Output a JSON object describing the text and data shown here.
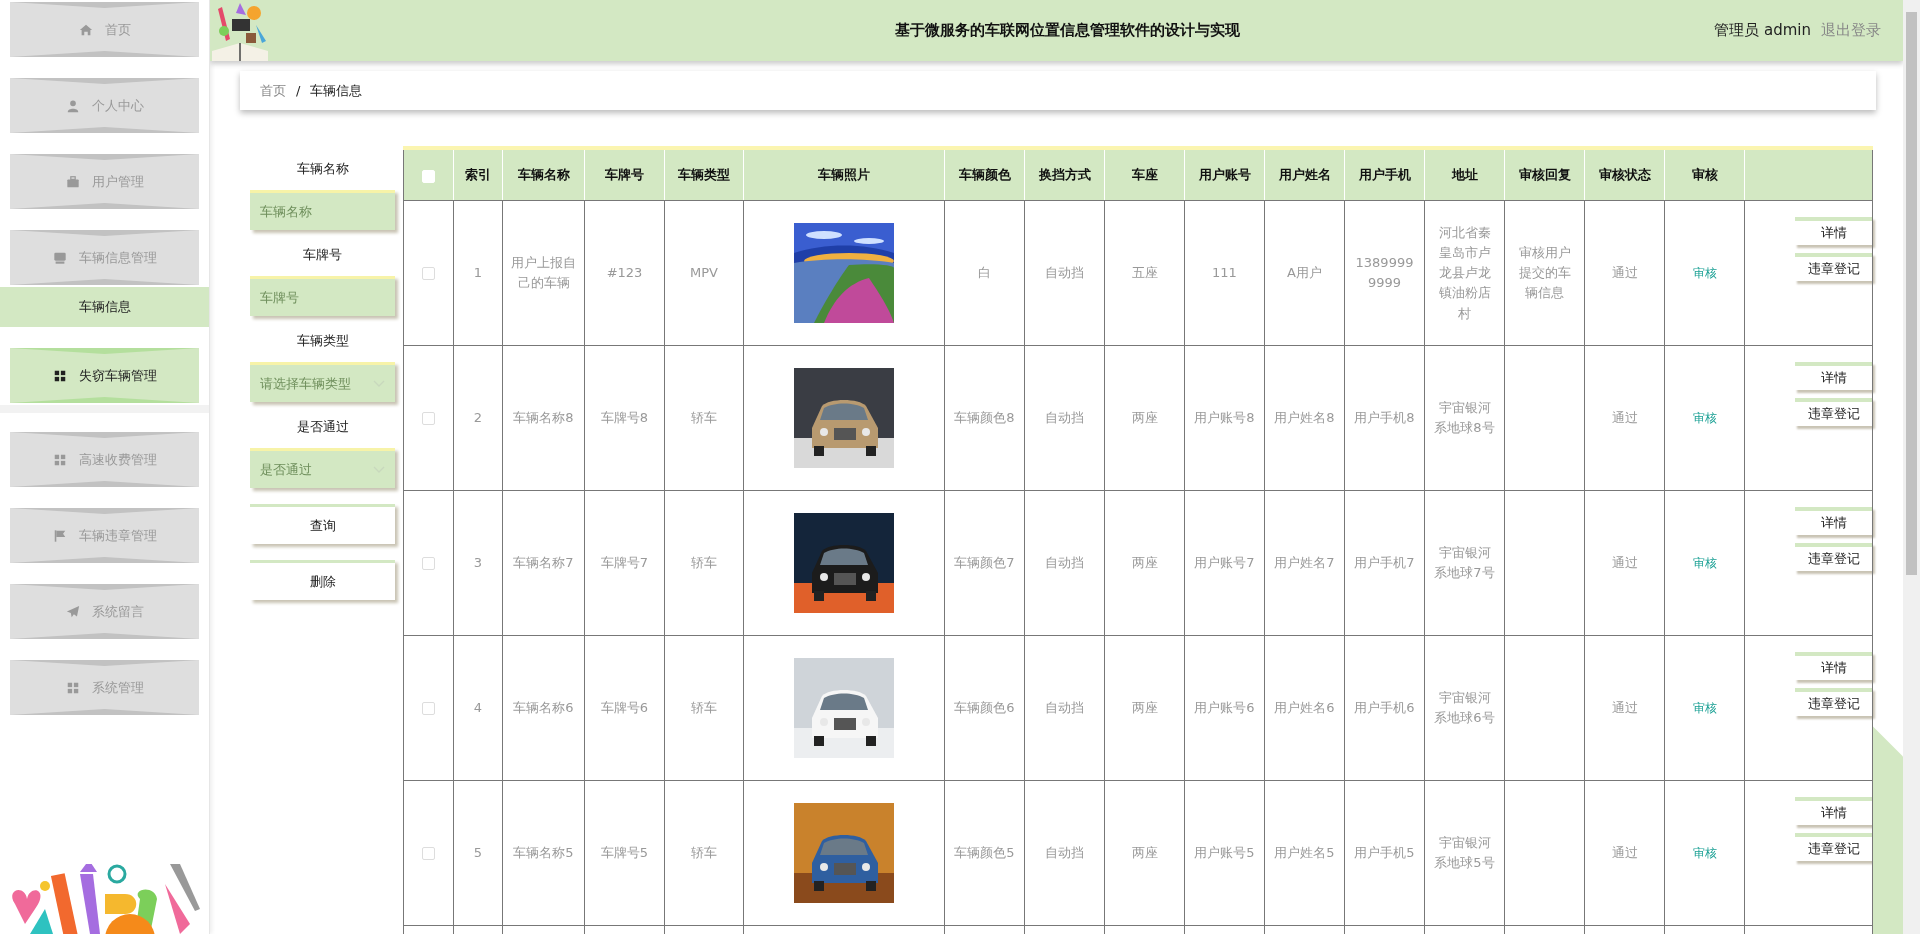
{
  "header": {
    "title": "基于微服务的车联网位置信息管理软件的设计与实现",
    "user": "管理员 admin",
    "logout": "退出登录"
  },
  "sidebar": {
    "items": [
      {
        "label": "首页",
        "selected": false,
        "hovered": false
      },
      {
        "label": "个人中心",
        "selected": false,
        "hovered": false
      },
      {
        "label": "用户管理",
        "selected": false,
        "hovered": false
      },
      {
        "label": "车辆信息管理",
        "selected": false,
        "hovered": false,
        "expanded": true,
        "children": [
          {
            "label": "车辆信息",
            "selected": true
          }
        ]
      },
      {
        "label": "失窃车辆管理",
        "selected": false,
        "hovered": true
      },
      {
        "label": "高速收费管理",
        "selected": false,
        "hovered": false
      },
      {
        "label": "车辆违章管理",
        "selected": false,
        "hovered": false
      },
      {
        "label": "系统留言",
        "selected": false,
        "hovered": false
      },
      {
        "label": "系统管理",
        "selected": false,
        "hovered": false
      }
    ]
  },
  "breadcrumb": {
    "items": [
      "首页",
      "车辆信息"
    ],
    "separator": "/"
  },
  "filters": {
    "fields": [
      {
        "kind": "input",
        "label": "车辆名称",
        "placeholder": "车辆名称"
      },
      {
        "kind": "input",
        "label": "车牌号",
        "placeholder": "车牌号"
      },
      {
        "kind": "select",
        "label": "车辆类型",
        "placeholder": "请选择车辆类型"
      },
      {
        "kind": "select",
        "label": "是否通过",
        "placeholder": "是否通过"
      }
    ],
    "buttons": [
      "查询",
      "删除"
    ]
  },
  "table": {
    "select_all": {
      "checked": false
    },
    "columns": [
      "索引",
      "车辆名称",
      "车牌号",
      "车辆类型",
      "车辆照片",
      "车辆颜色",
      "换挡方式",
      "车座",
      "用户账号",
      "用户姓名",
      "用户手机",
      "地址",
      "审核回复",
      "审核状态",
      "审核"
    ],
    "rows": [
      {
        "checked": false,
        "index": "1",
        "name": "用户上报自己的车辆",
        "plate": "#123",
        "type": "MPV",
        "vehicle_color": "白",
        "gear": "自动挡",
        "seats": "五座",
        "account": "111",
        "user_name": "A用户",
        "phone": "13899999999",
        "address": "河北省秦皇岛市卢龙县卢龙镇油粉店村",
        "review_reply": "审核用户提交的车辆信息",
        "review_status": "通过",
        "review_link": "审核",
        "actions": [
          "详情",
          "违章登记"
        ]
      },
      {
        "checked": false,
        "index": "2",
        "name": "车辆名称8",
        "plate": "车牌号8",
        "type": "轿车",
        "vehicle_color": "车辆颜色8",
        "gear": "自动挡",
        "seats": "两座",
        "account": "用户账号8",
        "user_name": "用户姓名8",
        "phone": "用户手机8",
        "address": "宇宙银河系地球8号",
        "review_status": "通过",
        "review_link": "审核",
        "actions": [
          "详情",
          "违章登记"
        ]
      },
      {
        "checked": false,
        "index": "3",
        "name": "车辆名称7",
        "plate": "车牌号7",
        "type": "轿车",
        "vehicle_color": "车辆颜色7",
        "gear": "自动挡",
        "seats": "两座",
        "account": "用户账号7",
        "user_name": "用户姓名7",
        "phone": "用户手机7",
        "address": "宇宙银河系地球7号",
        "review_status": "通过",
        "review_link": "审核",
        "actions": [
          "详情",
          "违章登记"
        ]
      },
      {
        "checked": false,
        "index": "4",
        "name": "车辆名称6",
        "plate": "车牌号6",
        "type": "轿车",
        "vehicle_color": "车辆颜色6",
        "gear": "自动挡",
        "seats": "两座",
        "account": "用户账号6",
        "user_name": "用户姓名6",
        "phone": "用户手机6",
        "address": "宇宙银河系地球6号",
        "review_status": "通过",
        "review_link": "审核",
        "actions": [
          "详情",
          "违章登记"
        ]
      },
      {
        "checked": false,
        "index": "5",
        "name": "车辆名称5",
        "plate": "车牌号5",
        "type": "轿车",
        "vehicle_color": "车辆颜色5",
        "gear": "自动挡",
        "seats": "两座",
        "account": "用户账号5",
        "user_name": "用户姓名5",
        "phone": "用户手机5",
        "address": "宇宙银河系地球5号",
        "review_status": "通过",
        "review_link": "审核",
        "actions": [
          "详情",
          "违章登记"
        ]
      }
    ]
  }
}
